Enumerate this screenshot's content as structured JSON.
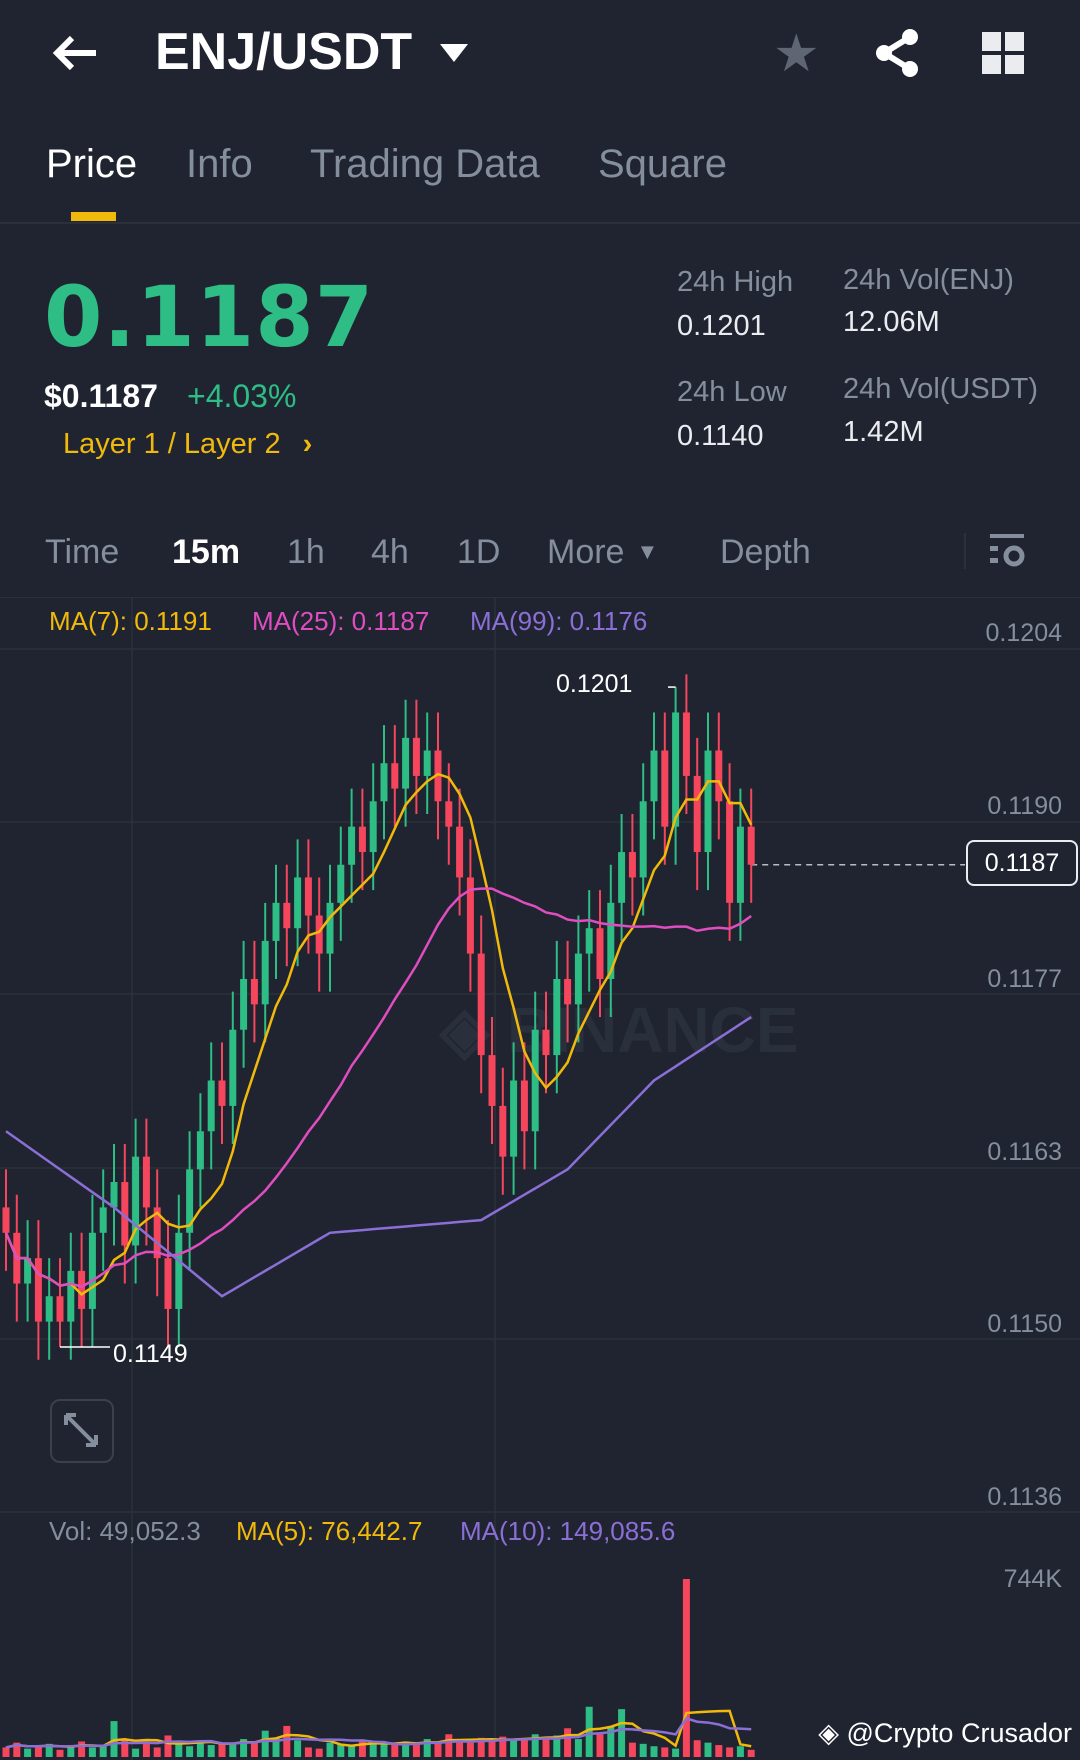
{
  "header": {
    "title": "ENJ/USDT"
  },
  "tabs": [
    {
      "label": "Price"
    },
    {
      "label": "Info"
    },
    {
      "label": "Trading Data"
    },
    {
      "label": "Square"
    }
  ],
  "ticker": {
    "last": "0.1187",
    "usd": "$0.1187",
    "change": "+4.03%",
    "category": "Layer 1 / Layer 2",
    "high_label": "24h High",
    "high": "0.1201",
    "low_label": "24h Low",
    "low": "0.1140",
    "vol_base_label": "24h Vol(ENJ)",
    "vol_base": "12.06M",
    "vol_quote_label": "24h Vol(USDT)",
    "vol_quote": "1.42M"
  },
  "timeframes": [
    {
      "label": "Time"
    },
    {
      "label": "15m"
    },
    {
      "label": "1h"
    },
    {
      "label": "4h"
    },
    {
      "label": "1D"
    },
    {
      "label": "More"
    },
    {
      "label": "Depth"
    }
  ],
  "indicators": {
    "ma7": "MA(7): 0.1191",
    "ma25": "MA(25): 0.1187",
    "ma99": "MA(99): 0.1176",
    "vol": "Vol: 49,052.3",
    "vma5": "MA(5): 76,442.7",
    "vma10": "MA(10): 149,085.6"
  },
  "watermark": "@Crypto Crusador",
  "colors": {
    "up": "#2ebd85",
    "down": "#f6465d",
    "ma7": "#f0b90b",
    "ma25": "#e04dc0",
    "ma99": "#8b6fd6"
  },
  "chart_data": {
    "type": "candlestick",
    "price_axis": [
      "0.1204",
      "0.1190",
      "0.1177",
      "0.1163",
      "0.1150",
      "0.1136"
    ],
    "ylim": [
      0.1136,
      0.1204
    ],
    "current_price": "0.1187",
    "max_label": "0.1201",
    "min_label": "0.1149",
    "volume_axis": "744K",
    "volume_max": 744,
    "open0": 1160,
    "closes": [
      1158,
      1154,
      1156,
      1151,
      1153,
      1151,
      1155,
      1152,
      1158,
      1160,
      1162,
      1157,
      1164,
      1160,
      1156,
      1152,
      1158,
      1163,
      1166,
      1170,
      1168,
      1174,
      1178,
      1176,
      1181,
      1184,
      1182,
      1186,
      1183,
      1180,
      1184,
      1187,
      1190,
      1188,
      1192,
      1195,
      1193,
      1197,
      1194,
      1196,
      1192,
      1190,
      1186,
      1180,
      1172,
      1168,
      1164,
      1170,
      1166,
      1174,
      1172,
      1178,
      1176,
      1180,
      1182,
      1178,
      1184,
      1188,
      1186,
      1192,
      1196,
      1190,
      1199,
      1194,
      1188,
      1196,
      1192,
      1184,
      1190,
      1187
    ],
    "volumes_k": [
      40,
      60,
      35,
      45,
      55,
      30,
      50,
      65,
      40,
      45,
      150,
      70,
      35,
      55,
      40,
      90,
      60,
      45,
      70,
      50,
      55,
      60,
      75,
      65,
      110,
      80,
      130,
      70,
      40,
      35,
      60,
      55,
      45,
      70,
      55,
      60,
      50,
      65,
      55,
      75,
      60,
      95,
      70,
      60,
      80,
      65,
      85,
      75,
      70,
      95,
      80,
      90,
      120,
      75,
      210,
      95,
      130,
      200,
      60,
      55,
      45,
      40,
      35,
      744,
      70,
      60,
      50,
      40,
      45,
      30
    ],
    "ma99_points": [
      [
        0,
        1166
      ],
      [
        10,
        1160
      ],
      [
        20,
        1153
      ],
      [
        30,
        1158
      ],
      [
        44,
        1159
      ],
      [
        52,
        1163
      ],
      [
        60,
        1170
      ],
      [
        69,
        1175
      ]
    ]
  }
}
